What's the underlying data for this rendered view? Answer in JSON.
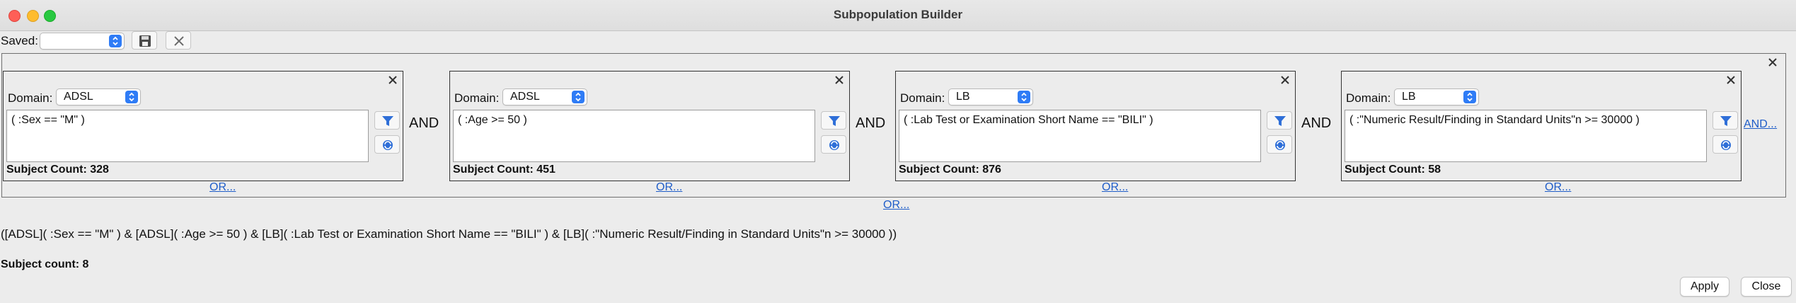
{
  "window": {
    "title": "Subpopulation Builder"
  },
  "toolbar": {
    "saved_label": "Saved:",
    "saved_value": ""
  },
  "connector": "AND",
  "and_link": "AND...",
  "outer_or_link": "OR...",
  "cards": [
    {
      "domain_label": "Domain:",
      "domain": "ADSL",
      "expression": "( :Sex == \"M\" )",
      "count": "Subject Count: 328",
      "or_link": "OR..."
    },
    {
      "domain_label": "Domain:",
      "domain": "ADSL",
      "expression": "( :Age >= 50 )",
      "count": "Subject Count: 451",
      "or_link": "OR..."
    },
    {
      "domain_label": "Domain:",
      "domain": "LB",
      "expression": "( :Lab Test or Examination Short Name == \"BILI\" )",
      "count": "Subject Count: 876",
      "or_link": "OR..."
    },
    {
      "domain_label": "Domain:",
      "domain": "LB",
      "expression": "( :\"Numeric Result/Finding in Standard Units\"n >= 30000 )",
      "count": "Subject Count: 58",
      "or_link": "OR..."
    }
  ],
  "summary": {
    "expression": "([ADSL]( :Sex == \"M\" ) & [ADSL]( :Age >= 50 ) & [LB]( :Lab Test or Examination Short Name == \"BILI\" ) & [LB]( :\"Numeric Result/Finding in Standard Units\"n >= 30000 ))"
  },
  "result": {
    "subject_count": "Subject count: 8"
  },
  "buttons": {
    "apply": "Apply",
    "close": "Close"
  },
  "colors": {
    "link": "#1f5dc8",
    "accent": "#2f7cf6",
    "filter_icon": "#2f6fd8"
  },
  "icons": [
    "save-icon",
    "clear-icon",
    "close-icon",
    "filter-icon",
    "refresh-icon",
    "chevron-updown-icon"
  ]
}
